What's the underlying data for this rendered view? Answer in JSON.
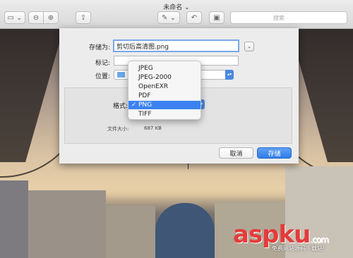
{
  "window": {
    "title": "未命名 ⌄"
  },
  "toolbar": {
    "search_placeholder": "搜索"
  },
  "dialog": {
    "save_as_label": "存储为:",
    "save_as_value": "剪切后高清图.png",
    "tags_label": "标记:",
    "tags_value": "",
    "location_label": "位置:",
    "format_label": "格式:",
    "file_size_label": "文件大小:",
    "file_size_value": "687 KB",
    "cancel_label": "取消",
    "save_label": "存储"
  },
  "format_menu": {
    "items": [
      "JPEG",
      "JPEG-2000",
      "OpenEXR",
      "PDF",
      "PNG",
      "TIFF"
    ],
    "selected": "PNG",
    "check": "✓"
  },
  "watermark": {
    "text": "aspku",
    "suffix": ".com",
    "subtitle": "免费网站源码下载站!"
  },
  "colors": {
    "accent": "#3b82f0",
    "save_button": "#2e7ce8",
    "watermark": "#e43b3b"
  }
}
